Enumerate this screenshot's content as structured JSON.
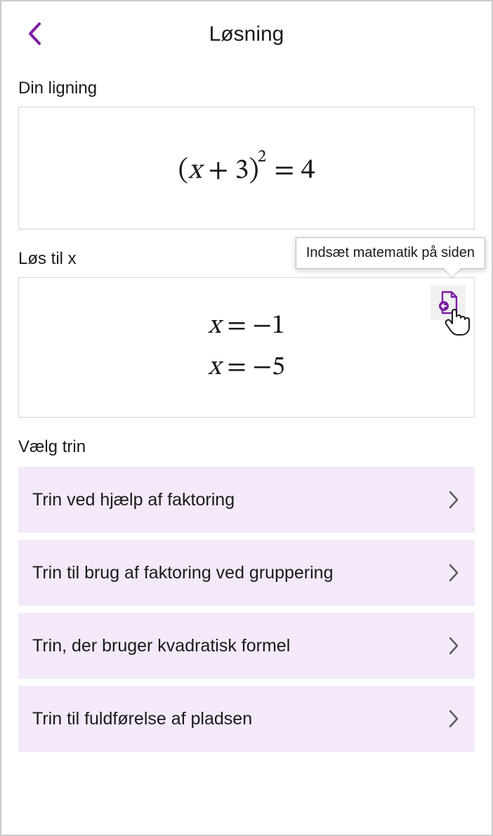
{
  "header": {
    "title": "Løsning"
  },
  "equation": {
    "label": "Din ligning",
    "display_html": "(<span class='var'>x</span> + 3)<sup>2</sup> = 4"
  },
  "solve": {
    "label": "Løs til x",
    "solutions_html": "<span class='var'>x</span> = −1<br><span class='var'>x</span> = −5",
    "tooltip": "Indsæt matematik på siden"
  },
  "steps": {
    "label": "Vælg trin",
    "items": [
      {
        "label": "Trin ved hjælp af faktoring"
      },
      {
        "label": "Trin til brug af faktoring ved gruppering"
      },
      {
        "label": "Trin, der bruger kvadratisk formel"
      },
      {
        "label": "Trin til fuldførelse af pladsen"
      }
    ]
  }
}
